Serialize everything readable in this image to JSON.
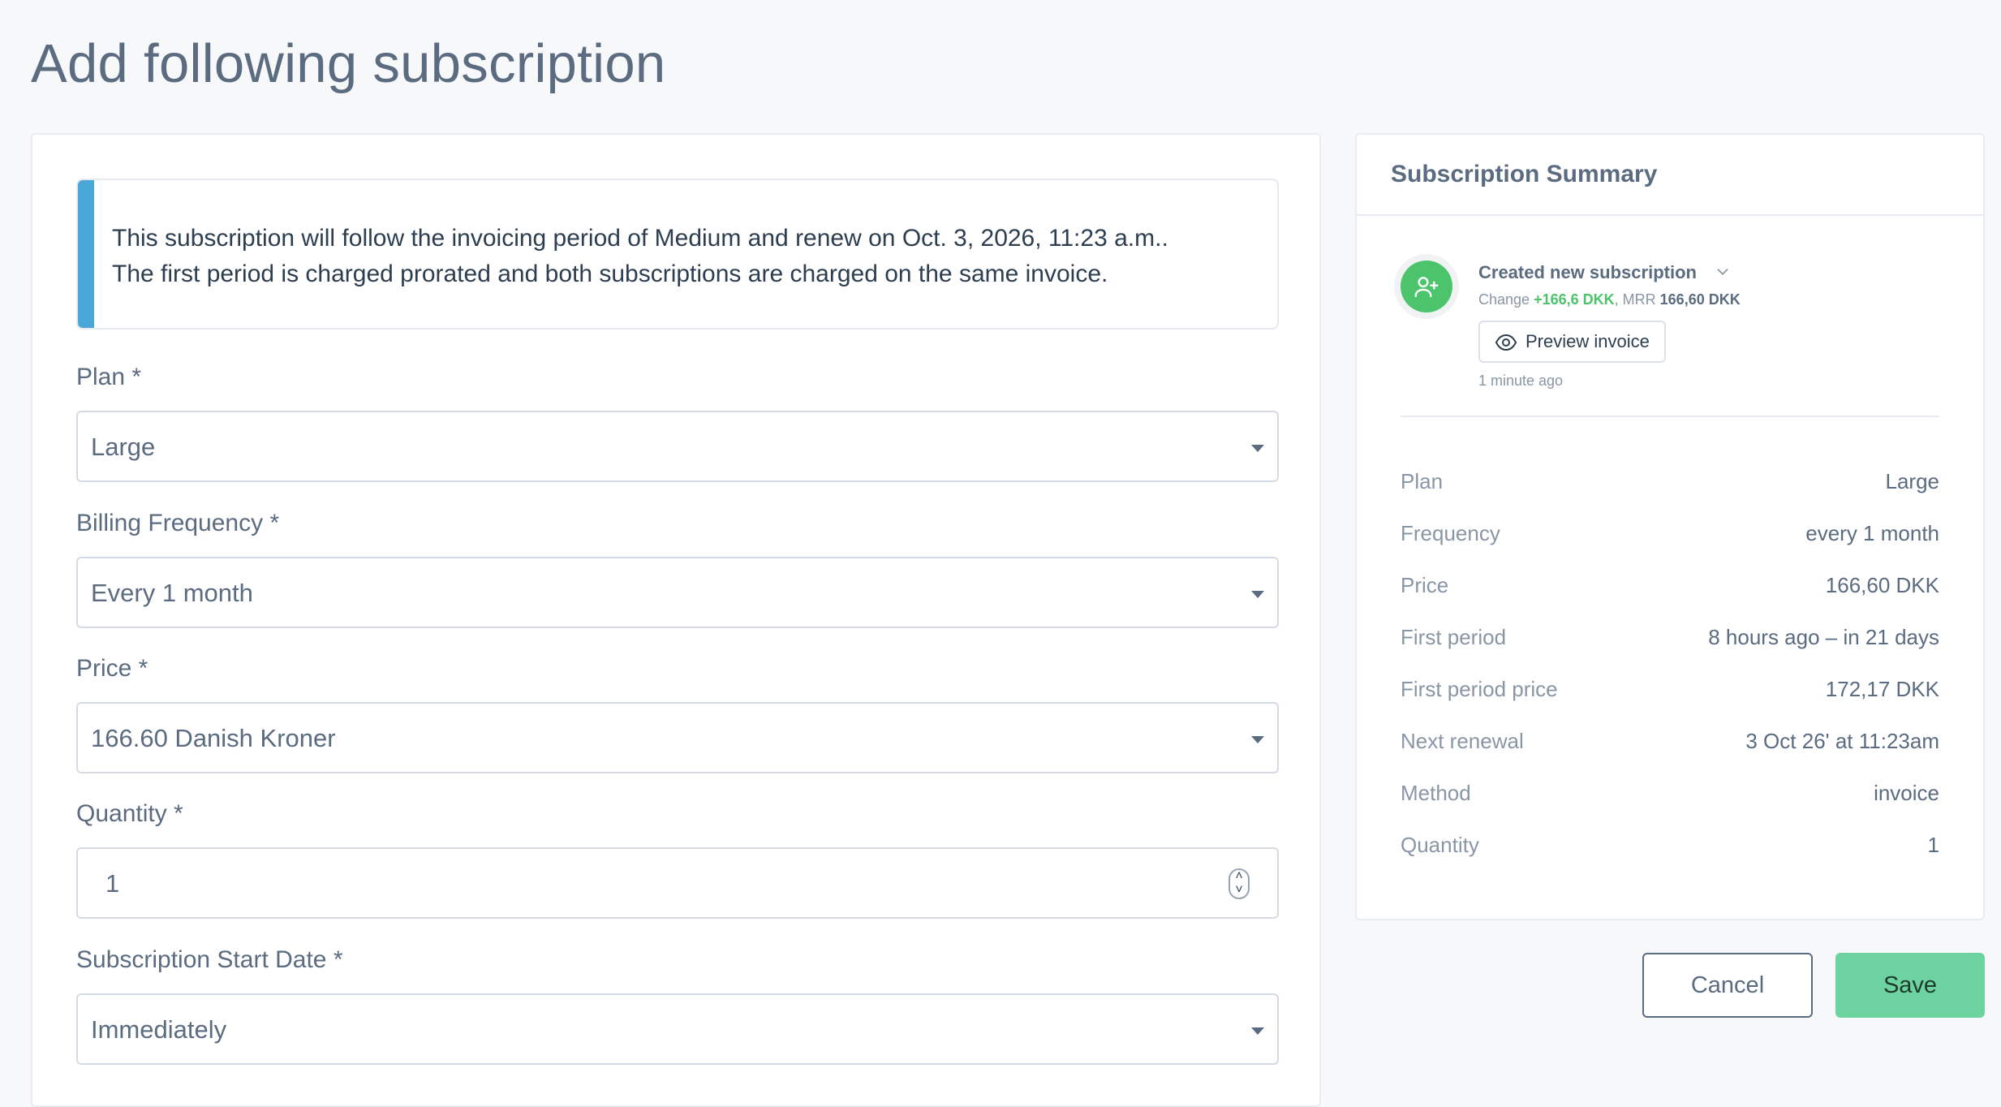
{
  "page": {
    "title": "Add following subscription"
  },
  "info": {
    "line1": "This subscription will follow the invoicing period of Medium and renew on Oct. 3, 2026, 11:23 a.m..",
    "line2": "The first period is charged prorated and both subscriptions are charged on the same invoice."
  },
  "form": {
    "plan": {
      "label": "Plan *",
      "value": "Large"
    },
    "billing_frequency": {
      "label": "Billing Frequency *",
      "value": "Every 1 month"
    },
    "price": {
      "label": "Price *",
      "value": "166.60 Danish Kroner"
    },
    "quantity": {
      "label": "Quantity *",
      "value": "1"
    },
    "start_date": {
      "label": "Subscription Start Date *",
      "value": "Immediately"
    }
  },
  "summary": {
    "title": "Subscription Summary",
    "event": {
      "title": "Created new subscription",
      "change_label": "Change",
      "change_value": "+166,6 DKK",
      "mrr_label": ", MRR",
      "mrr_value": "166,60 DKK",
      "preview_label": "Preview invoice",
      "time": "1 minute ago"
    },
    "rows": [
      {
        "label": "Plan",
        "value": "Large"
      },
      {
        "label": "Frequency",
        "value": "every 1 month"
      },
      {
        "label": "Price",
        "value": "166,60 DKK"
      },
      {
        "label": "First period",
        "value": "8 hours ago – in 21 days"
      },
      {
        "label": "First period price",
        "value": "172,17 DKK"
      },
      {
        "label": "Next renewal",
        "value": "3 Oct 26' at 11:23am"
      },
      {
        "label": "Method",
        "value": "invoice"
      },
      {
        "label": "Quantity",
        "value": "1"
      }
    ]
  },
  "actions": {
    "cancel_label": "Cancel",
    "save_label": "Save"
  },
  "colors": {
    "accent_info": "#4aa8d8",
    "success": "#4cc46b",
    "save_button": "#6dd3a0"
  },
  "icons": {
    "avatar": "user-plus-icon",
    "chevron": "chevron-down-icon",
    "preview": "eye-icon",
    "stepper": "stepper-icon"
  }
}
